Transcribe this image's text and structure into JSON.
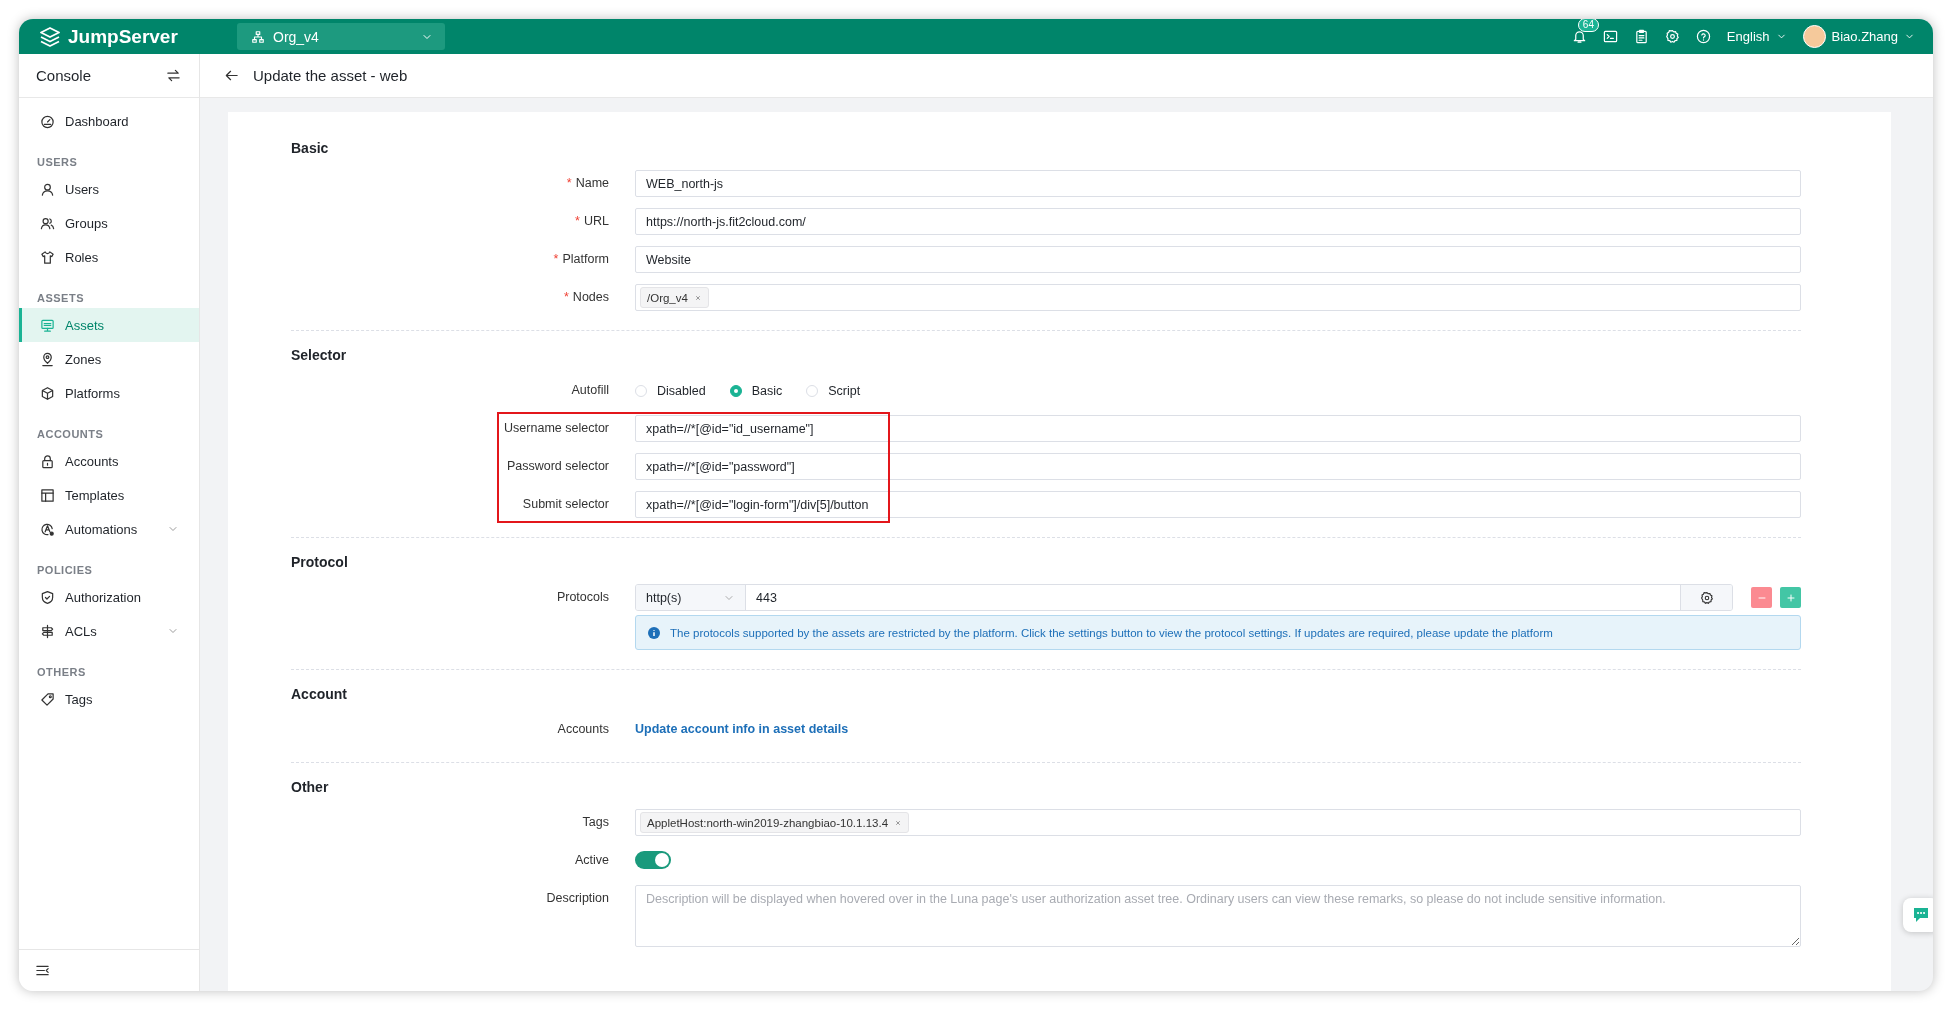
{
  "header": {
    "logo": "JumpServer",
    "org": "Org_v4",
    "notifications": "64",
    "language": "English",
    "user": "Biao.Zhang"
  },
  "sidebar": {
    "title": "Console",
    "sections": [
      {
        "items": [
          {
            "label": "Dashboard",
            "selected": false,
            "expandable": false
          }
        ]
      },
      {
        "heading": "USERS",
        "items": [
          {
            "label": "Users",
            "selected": false,
            "expandable": false
          },
          {
            "label": "Groups",
            "selected": false,
            "expandable": false
          },
          {
            "label": "Roles",
            "selected": false,
            "expandable": false
          }
        ]
      },
      {
        "heading": "ASSETS",
        "items": [
          {
            "label": "Assets",
            "selected": true,
            "expandable": false
          },
          {
            "label": "Zones",
            "selected": false,
            "expandable": false
          },
          {
            "label": "Platforms",
            "selected": false,
            "expandable": false
          }
        ]
      },
      {
        "heading": "ACCOUNTS",
        "items": [
          {
            "label": "Accounts",
            "selected": false,
            "expandable": false
          },
          {
            "label": "Templates",
            "selected": false,
            "expandable": false
          },
          {
            "label": "Automations",
            "selected": false,
            "expandable": true
          }
        ]
      },
      {
        "heading": "POLICIES",
        "items": [
          {
            "label": "Authorization",
            "selected": false,
            "expandable": false
          },
          {
            "label": "ACLs",
            "selected": false,
            "expandable": true
          }
        ]
      },
      {
        "heading": "OTHERS",
        "items": [
          {
            "label": "Tags",
            "selected": false,
            "expandable": false
          }
        ]
      }
    ]
  },
  "page": {
    "title": "Update the asset - web"
  },
  "form": {
    "sections": [
      {
        "title": "Basic",
        "rows": [
          {
            "kind": "text",
            "label": "Name",
            "marker": "*",
            "highlighted": false,
            "value": "WEB_north-js"
          },
          {
            "kind": "text",
            "label": "URL",
            "marker": "*",
            "highlighted": false,
            "value": "https://north-js.fit2cloud.com/"
          },
          {
            "kind": "text",
            "label": "Platform",
            "marker": "*",
            "highlighted": false,
            "value": "Website"
          },
          {
            "kind": "tags",
            "label": "Nodes",
            "marker": "*",
            "highlighted": false,
            "tags": [
              "/Org_v4"
            ]
          }
        ]
      },
      {
        "title": "Selector",
        "rows": [
          {
            "kind": "radio",
            "label": "Autofill",
            "highlighted": false,
            "options": [
              {
                "label": "Disabled",
                "selected": false
              },
              {
                "label": "Basic",
                "selected": true
              },
              {
                "label": "Script",
                "selected": false
              }
            ]
          },
          {
            "kind": "text",
            "label": "Username selector",
            "highlighted": true,
            "value": "xpath=//*[@id=\"id_username\"]"
          },
          {
            "kind": "text",
            "label": "Password selector",
            "highlighted": true,
            "value": "xpath=//*[@id=\"password\"]"
          },
          {
            "kind": "text",
            "label": "Submit selector",
            "highlighted": true,
            "value": "xpath=//*[@id=\"login-form\"]/div[5]/button"
          }
        ]
      },
      {
        "title": "Protocol",
        "rows": [
          {
            "kind": "protocol",
            "label": "Protocols",
            "highlighted": false,
            "protocol": "http(s)",
            "port": "443",
            "note": "The protocols supported by the assets are restricted by the platform. Click the settings button to view the protocol settings. If updates are required, please update the platform"
          }
        ]
      },
      {
        "title": "Account",
        "rows": [
          {
            "kind": "link",
            "label": "Accounts",
            "highlighted": false,
            "text": "Update account info in asset details"
          }
        ]
      },
      {
        "title": "Other",
        "rows": [
          {
            "kind": "tags",
            "label": "Tags",
            "highlighted": false,
            "tags": [
              "AppletHost:north-win2019-zhangbiao-10.1.13.4"
            ]
          },
          {
            "kind": "switch",
            "label": "Active",
            "highlighted": false,
            "on": true
          },
          {
            "kind": "textarea",
            "label": "Description",
            "highlighted": false,
            "placeholder": "Description will be displayed when hovered over in the Luna page's user authorization asset tree. Ordinary users can view these remarks, so please do not include sensitive information."
          }
        ]
      }
    ]
  }
}
